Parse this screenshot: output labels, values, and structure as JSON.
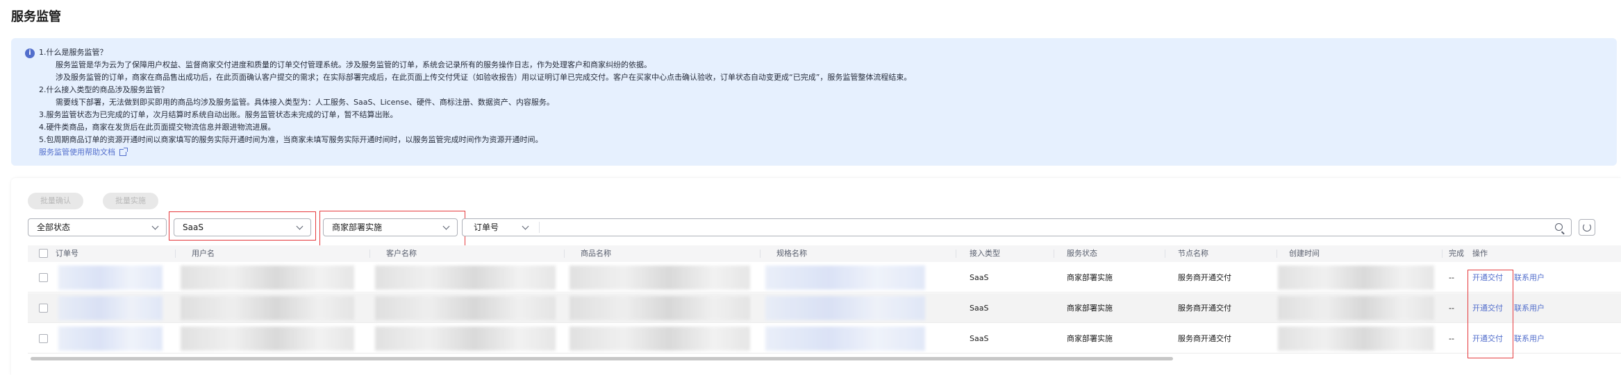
{
  "page": {
    "title": "服务监管"
  },
  "info": {
    "icon": "info-icon",
    "lines": [
      "1.什么是服务监管？",
      "服务监管是华为云为了保障用户权益、监督商家交付进度和质量的订单交付管理系统。涉及服务监管的订单，系统会记录所有的服务操作日志，作为处理客户和商家纠纷的依据。",
      "涉及服务监管的订单，商家在商品售出成功后，在此页面确认客户提交的需求；在实际部署完成后，在此页面上传交付凭证（如验收报告）用以证明订单已完成交付。客户在买家中心点击确认验收，订单状态自动变更成“已完成”，服务监管整体流程结束。",
      "2.什么接入类型的商品涉及服务监管？",
      "需要线下部署，无法做到即买即用的商品均涉及服务监管。具体接入类型为：人工服务、SaaS、License、硬件、商标注册、数据资产、内容服务。",
      "3.服务监管状态为已完成的订单，次月结算时系统自动出账。服务监管状态未完成的订单，暂不结算出账。",
      "4.硬件类商品，商家在发货后在此页面提交物流信息并跟进物流进展。",
      "5.包周期商品订单的资源开通时间以商家填写的服务实际开通时间为准，当商家未填写服务实际开通时间时，以服务监管完成时间作为资源开通时间。"
    ],
    "help_link": "服务监管使用帮助文档"
  },
  "toolbar": {
    "batch_confirm": "批量确认",
    "batch_implement": "批量实施"
  },
  "filters": {
    "status": "全部状态",
    "access_type": "SaaS",
    "service_status": "商家部署实施",
    "search_type": "订单号",
    "search_value": ""
  },
  "table": {
    "columns": [
      "订单号",
      "用户名",
      "客户名称",
      "商品名称",
      "规格名称",
      "接入类型",
      "服务状态",
      "节点名称",
      "创建时间",
      "完成",
      "操作"
    ],
    "rows": [
      {
        "access_type": "SaaS",
        "service_status": "商家部署实施",
        "node_name": "服务商开通交付",
        "completed": "--",
        "action_1": "开通交付",
        "action_2": "联系用户"
      },
      {
        "access_type": "SaaS",
        "service_status": "商家部署实施",
        "node_name": "服务商开通交付",
        "completed": "--",
        "action_1": "开通交付",
        "action_2": "联系用户"
      },
      {
        "access_type": "SaaS",
        "service_status": "商家部署实施",
        "node_name": "服务商开通交付",
        "completed": "--",
        "action_1": "开通交付",
        "action_2": "联系用户"
      }
    ]
  },
  "colors": {
    "link": "#526ecc",
    "highlight_box": "#e5383b",
    "info_bg": "#e6f0fe"
  }
}
